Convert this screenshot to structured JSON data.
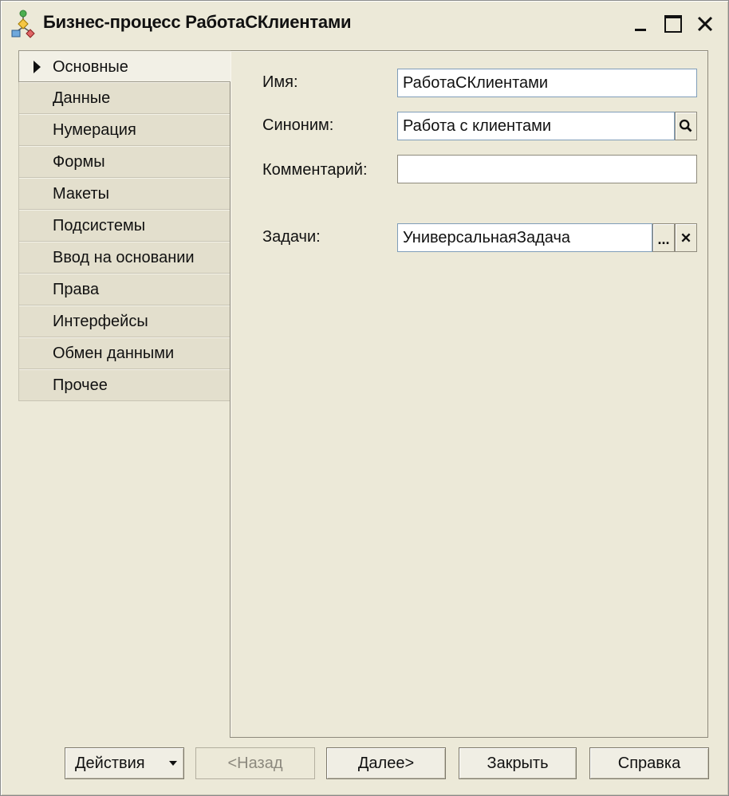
{
  "window": {
    "title": "Бизнес-процесс РаботаСКлиентами"
  },
  "tabs": [
    {
      "label": "Основные",
      "active": true
    },
    {
      "label": "Данные"
    },
    {
      "label": "Нумерация"
    },
    {
      "label": "Формы"
    },
    {
      "label": "Макеты"
    },
    {
      "label": "Подсистемы"
    },
    {
      "label": "Ввод на основании"
    },
    {
      "label": "Права"
    },
    {
      "label": "Интерфейсы"
    },
    {
      "label": "Обмен данными"
    },
    {
      "label": "Прочее"
    }
  ],
  "form": {
    "name_label": "Имя:",
    "name_value": "РаботаСКлиентами",
    "synonym_label": "Синоним:",
    "synonym_value": "Работа с клиентами",
    "comment_label": "Комментарий:",
    "comment_value": "",
    "tasks_label": "Задачи:",
    "tasks_value": "УниверсальнаяЗадача",
    "select_button_label": "..."
  },
  "buttons": {
    "actions": "Действия",
    "back": "<Назад",
    "next": "Далее>",
    "close": "Закрыть",
    "help": "Справка"
  },
  "icons": {
    "app": "business-process-icon",
    "search": "magnifier-icon",
    "clear": "close-x-icon"
  }
}
